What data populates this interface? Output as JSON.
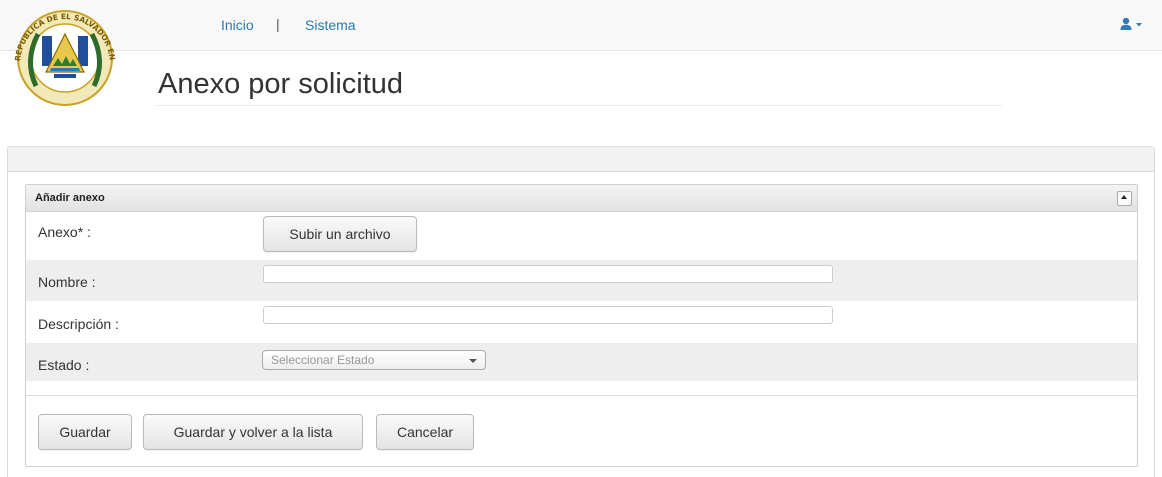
{
  "nav": {
    "links": [
      "Inicio",
      "Sistema"
    ],
    "separator": "|",
    "user_icon": "user-icon",
    "dropdown_icon": "caret-down-icon"
  },
  "logo": {
    "icon": "coat-of-arms-el-salvador",
    "seal_text": "REPUBLICA DE EL SALVADOR EN LA AMERICA CENTRAL"
  },
  "page": {
    "title": "Anexo por solicitud"
  },
  "form": {
    "header": "Añadir anexo",
    "collapse_icon": "collapse-up-icon",
    "fields": {
      "anexo": {
        "label": "Anexo* :",
        "button": "Subir un archivo"
      },
      "nombre": {
        "label": "Nombre :",
        "value": ""
      },
      "descripcion": {
        "label": "Descripción :",
        "value": ""
      },
      "estado": {
        "label": "Estado :",
        "placeholder": "Seleccionar Estado"
      }
    },
    "actions": [
      "Guardar",
      "Guardar y volver a la lista",
      "Cancelar"
    ]
  },
  "colors": {
    "link": "#2a7ab0",
    "user_icon": "#337ab7",
    "alt_row": "#eeeeee"
  }
}
